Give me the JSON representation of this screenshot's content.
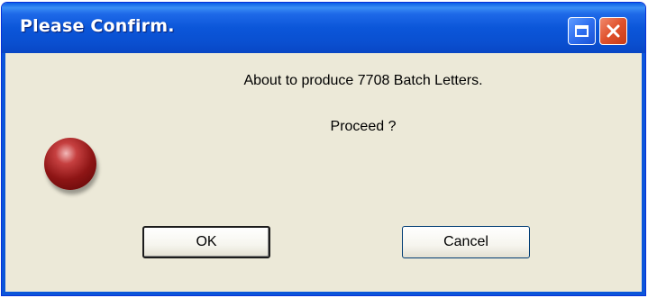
{
  "dialog": {
    "title": "Please Confirm.",
    "message": "About to produce 7708 Batch Letters.",
    "question": "Proceed ?",
    "icon": "red-ball-icon"
  },
  "titlebar": {
    "buttons": [
      "restore-icon",
      "close-icon"
    ],
    "color": "#0b56d9"
  },
  "buttons": {
    "ok_label": "OK",
    "cancel_label": "Cancel"
  }
}
